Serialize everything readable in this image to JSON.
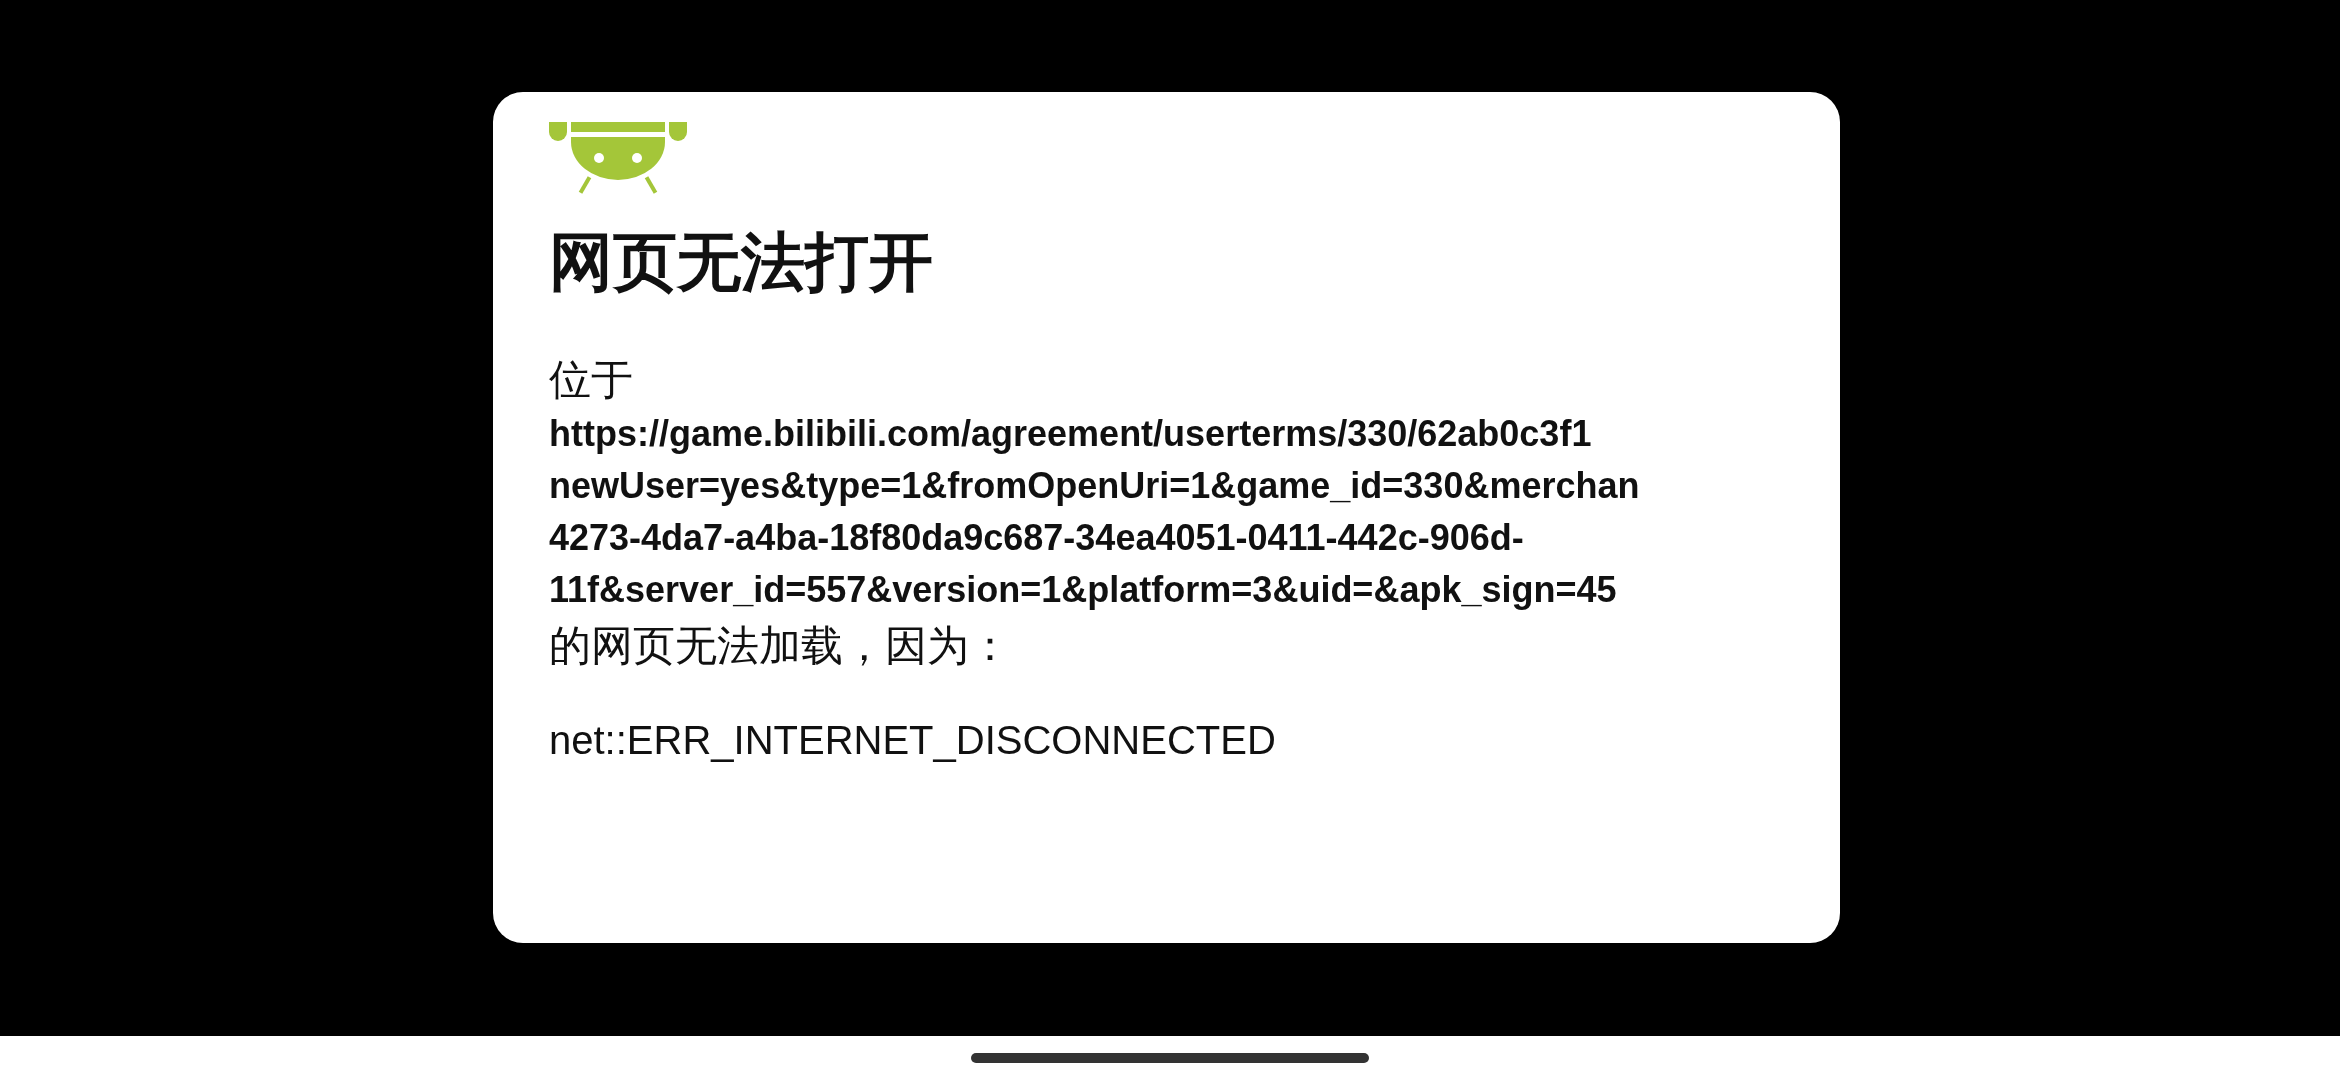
{
  "error_page": {
    "title": "网页无法打开",
    "located_at": "位于",
    "url_lines": [
      "https://game.bilibili.com/agreement/userterms/330/62ab0c3f1",
      "newUser=yes&type=1&fromOpenUri=1&game_id=330&merchan",
      "4273-4da7-a4ba-18f80da9c687-34ea4051-0411-442c-906d-",
      "11f&server_id=557&version=1&platform=3&uid=&apk_sign=45"
    ],
    "reason_intro": "的网页无法加载，因为：",
    "error_code": "net::ERR_INTERNET_DISCONNECTED"
  }
}
